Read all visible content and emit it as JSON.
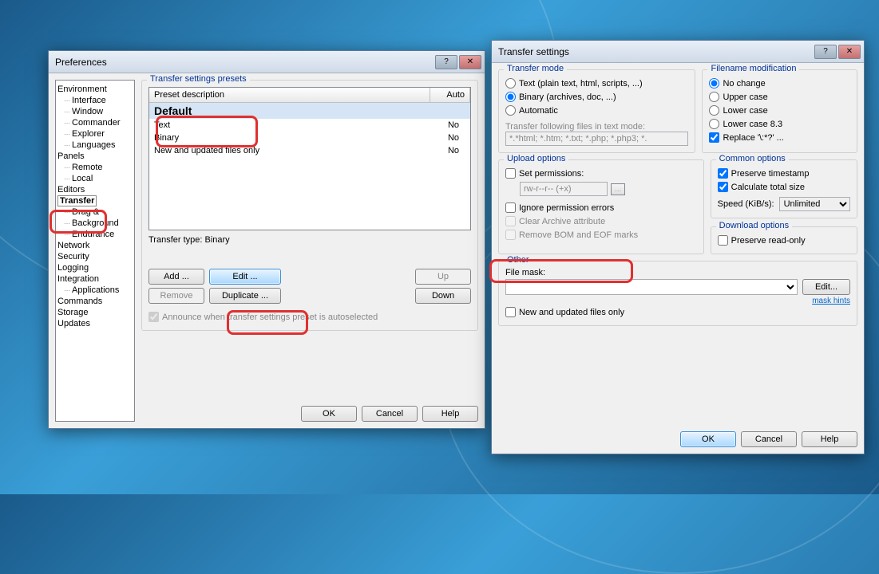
{
  "prefs": {
    "title": "Preferences",
    "tree": {
      "environment": "Environment",
      "interface": "Interface",
      "window": "Window",
      "commander": "Commander",
      "explorer": "Explorer",
      "languages": "Languages",
      "panels": "Panels",
      "remote": "Remote",
      "local": "Local",
      "editors": "Editors",
      "transfer": "Transfer",
      "dragdrop": "Drag &",
      "background": "Background",
      "endurance": "Endurance",
      "network": "Network",
      "security": "Security",
      "logging": "Logging",
      "integration": "Integration",
      "applications": "Applications",
      "commands": "Commands",
      "storage": "Storage",
      "updates": "Updates"
    },
    "presets": {
      "group": "Transfer settings presets",
      "col_desc": "Preset description",
      "col_auto": "Auto",
      "rows": [
        {
          "desc": "Default",
          "auto": ""
        },
        {
          "desc": "Text",
          "auto": "No"
        },
        {
          "desc": "Binary",
          "auto": "No"
        },
        {
          "desc": "New and updated files only",
          "auto": "No"
        }
      ],
      "type_line": "Transfer type: Binary",
      "add": "Add ...",
      "edit": "Edit ...",
      "remove": "Remove",
      "duplicate": "Duplicate ...",
      "up": "Up",
      "down": "Down",
      "announce": "Announce when transfer settings preset is autoselected"
    },
    "footer": {
      "ok": "OK",
      "cancel": "Cancel",
      "help": "Help"
    }
  },
  "ts": {
    "title": "Transfer settings",
    "mode": {
      "group": "Transfer mode",
      "text": "Text (plain text, html, scripts, ...)",
      "binary": "Binary (archives, doc, ...)",
      "auto": "Automatic",
      "following": "Transfer following files in text mode:",
      "pattern": "*.*html; *.htm; *.txt; *.php; *.php3; *."
    },
    "filename": {
      "group": "Filename modification",
      "nochange": "No change",
      "upper": "Upper case",
      "lower": "Lower case",
      "lower83": "Lower case 8.3",
      "replace": "Replace '\\:*?' ..."
    },
    "upload": {
      "group": "Upload options",
      "setperm": "Set permissions:",
      "perm_val": "rw-r--r-- (+x)",
      "perm_btn": "...",
      "ignore": "Ignore permission errors",
      "clear": "Clear Archive attribute",
      "remove": "Remove BOM and EOF marks"
    },
    "common": {
      "group": "Common options",
      "preserve": "Preserve timestamp",
      "calc": "Calculate total size",
      "speed": "Speed (KiB/s):",
      "speed_val": "Unlimited"
    },
    "download": {
      "group": "Download options",
      "readonly": "Preserve read-only"
    },
    "other": {
      "group": "Other",
      "mask": "File mask:",
      "edit": "Edit...",
      "hints": "mask hints",
      "newupdated": "New and updated files only"
    },
    "footer": {
      "ok": "OK",
      "cancel": "Cancel",
      "help": "Help"
    }
  }
}
